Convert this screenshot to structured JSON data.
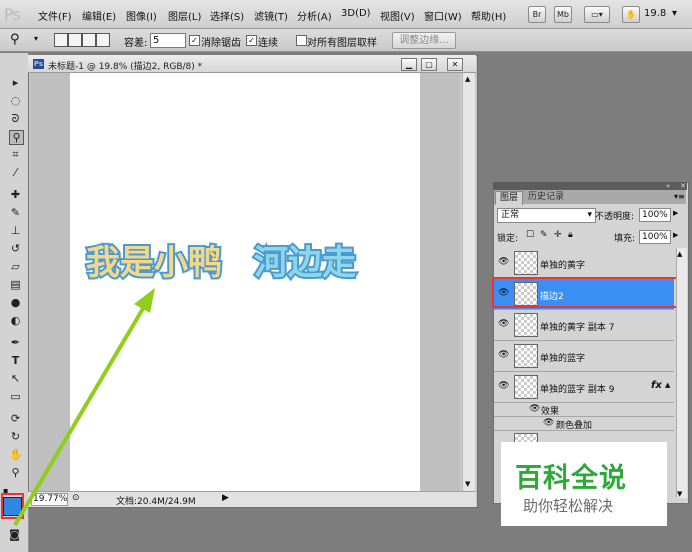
{
  "app": {
    "logo": "Ps",
    "zoom_readout": "19.8"
  },
  "menu": [
    "文件(F)",
    "编辑(E)",
    "图像(I)",
    "图层(L)",
    "选择(S)",
    "滤镜(T)",
    "分析(A)",
    "3D(D)",
    "视图(V)",
    "窗口(W)",
    "帮助(H)"
  ],
  "menubar_buttons": [
    "Br",
    "Mb"
  ],
  "options": {
    "tolerance_label": "容差:",
    "tolerance_value": "5",
    "antialias_label": "消除锯齿",
    "contiguous_label": "连续",
    "sample_all_label": "对所有图层取样",
    "refine_edge": "调整边缘..."
  },
  "document": {
    "title": "未标题-1 @ 19.8% (描边2, RGB/8) *",
    "canvas_text_yellow": "我是小鸭",
    "canvas_text_blue": "河边走",
    "zoom": "19.77%",
    "info": "文档:20.4M/24.9M"
  },
  "layers_panel": {
    "tabs": [
      "图层",
      "历史记录"
    ],
    "blend_mode": "正常",
    "opacity_label": "不透明度:",
    "opacity_value": "100%",
    "lock_label": "锁定:",
    "fill_label": "填充:",
    "fill_value": "100%",
    "layers": [
      {
        "name": "单独的黄字",
        "selected": false
      },
      {
        "name": "描边2",
        "selected": true
      },
      {
        "name": "单独的黄字 副本 7",
        "selected": false
      },
      {
        "name": "单独的蓝字",
        "selected": false
      },
      {
        "name": "单独的蓝字 副本 9",
        "selected": false,
        "fx": "fx"
      }
    ],
    "effects_label": "效果",
    "color_overlay_label": "颜色叠加"
  },
  "watermark": {
    "title": "百科全说",
    "subtitle": "助你轻松解决"
  },
  "colors": {
    "foreground": "#2f88e0",
    "highlight": "#e33333",
    "arrow": "#8fce1a",
    "selection": "#3b8ff2"
  }
}
